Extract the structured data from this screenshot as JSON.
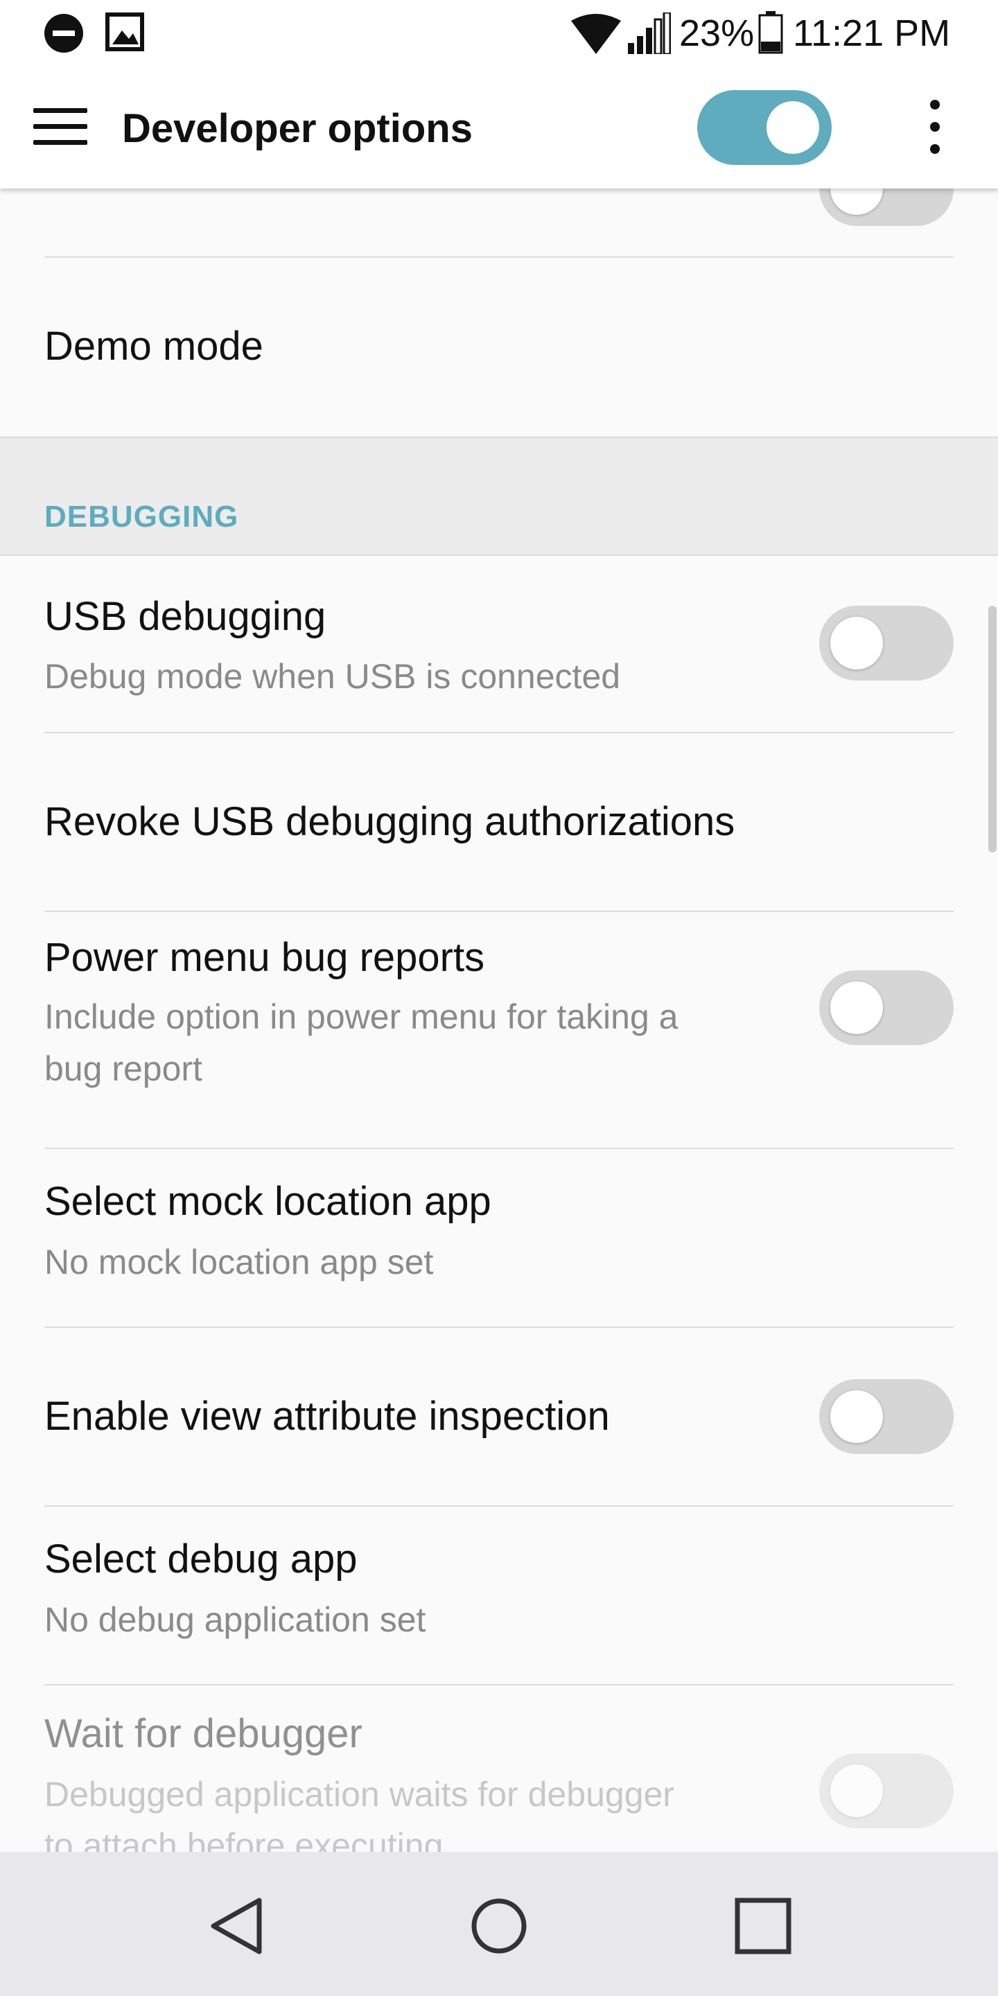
{
  "status_bar": {
    "battery_percent": "23%",
    "time": "11:21 PM",
    "icons": [
      "do-not-disturb-icon",
      "gallery-icon",
      "wifi-icon",
      "signal-icon",
      "battery-icon"
    ]
  },
  "app_bar": {
    "title": "Developer options",
    "master_toggle_on": true,
    "accent_color": "#5eacbe"
  },
  "settings": {
    "demo_mode": {
      "title": "Demo mode"
    },
    "section_header": "DEBUGGING",
    "usb_debugging": {
      "title": "USB debugging",
      "subtitle": "Debug mode when USB is connected",
      "on": false
    },
    "revoke_usb": {
      "title": "Revoke USB debugging authorizations"
    },
    "power_menu_bug": {
      "title": "Power menu bug reports",
      "subtitle_line1": "Include option in power menu for taking a",
      "subtitle_line2": "bug report",
      "on": false
    },
    "mock_location": {
      "title": "Select mock location app",
      "subtitle": "No mock location app set"
    },
    "view_attribute": {
      "title": "Enable view attribute inspection",
      "on": false
    },
    "debug_app": {
      "title": "Select debug app",
      "subtitle": "No debug application set"
    },
    "wait_debugger": {
      "title": "Wait for debugger",
      "subtitle_line1": "Debugged application waits for debugger",
      "subtitle_line2": "to attach before executing",
      "on": false,
      "enabled": false
    }
  },
  "nav_bar": {
    "buttons": [
      "back-icon",
      "home-icon",
      "recents-icon"
    ]
  }
}
